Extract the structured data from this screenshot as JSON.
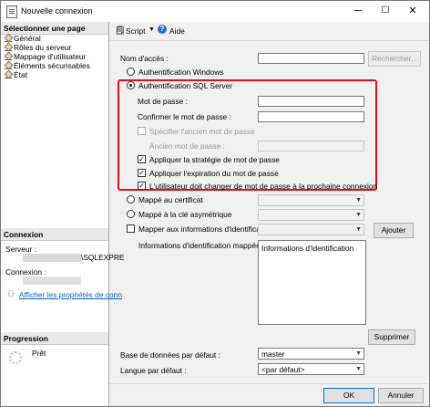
{
  "window": {
    "title": "Nouvelle connexion",
    "minimize": "─",
    "maximize": "☐",
    "close": "✕"
  },
  "left": {
    "select_header": "Sélectionner une page",
    "pages": [
      {
        "label": "Général"
      },
      {
        "label": "Rôles du serveur"
      },
      {
        "label": "Mappage d'utilisateur"
      },
      {
        "label": "Éléments sécurisables"
      },
      {
        "label": "État"
      }
    ],
    "connection_header": "Connexion",
    "server_label": "Serveur :",
    "server_value": "\\SQLEXPRE",
    "connection_label": "Connexion :",
    "view_props_link": "Afficher les propriétés de conn",
    "progress_header": "Progression",
    "progress_status": "Prêt"
  },
  "toolbar": {
    "script": "Script",
    "help": "Aide"
  },
  "form": {
    "login_name_label": "Nom d'accès :",
    "search_button": "Rechercher...",
    "windows_auth": "Authentification Windows",
    "sql_auth": "Authentification SQL Server",
    "password_label": "Mot de passe :",
    "confirm_label": "Confirmer le mot de passe :",
    "specify_old": "Spécifier l'ancien mot de passe",
    "old_password_label": "Ancien mot de passe :",
    "enforce_policy": "Appliquer la stratégie de mot de passe",
    "enforce_expiration": "Appliquer l'expiration du mot de passe",
    "must_change": "L'utilisateur doit changer de mot de passe à la prochaine connexion",
    "cert_mapped": "Mappé au certificat",
    "asym_key_mapped": "Mappé à la clé asymétrique",
    "map_credentials": "Mapper aux informations d'identification",
    "add_button": "Ajouter",
    "mapped_credentials_label": "Informations d'identification mappées",
    "credentials_column": "Informations d'identification",
    "remove_button": "Supprimer",
    "default_db_label": "Base de données par défaut :",
    "default_db_value": "master",
    "default_lang_label": "Langue par défaut :",
    "default_lang_value": "<par défaut>"
  },
  "footer": {
    "ok": "OK",
    "cancel": "Annuler"
  }
}
